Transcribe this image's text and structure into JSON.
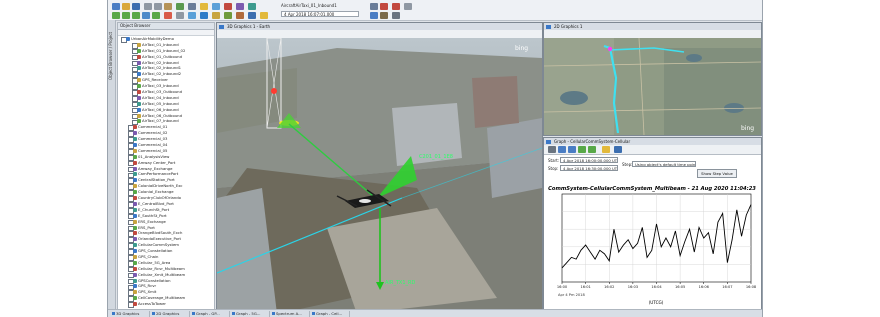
{
  "window": {
    "title": "AircraftAirTaxi_01_Inbound1",
    "datetime": "4 Apr 2018 16:07:01.000"
  },
  "sidebar_tab": "Object Browser / Project",
  "browser": {
    "title": "Object Browser",
    "items": [
      "UrbanAirMobilityDemo",
      "AirTaxi_01_Inbound",
      "AirTaxi_01_Inbound_02",
      "AirTaxi_01_Outbound",
      "AirTaxi_02_Inbound",
      "AirTaxi_02_Inbound1",
      "AirTaxi_02_Inbound2",
      "GPS_Receiver",
      "AirTaxi_03_Inbound",
      "AirTaxi_03_Outbound",
      "AirTaxi_04_Inbound",
      "AirTaxi_05_Inbound",
      "AirTaxi_06_Inbound",
      "AirTaxi_06_Outbound",
      "AirTaxi_07_Inbound",
      "Commercial_01",
      "Commercial_02",
      "Commercial_03",
      "Commercial_04",
      "Commercial_05",
      "01_AnalysisView",
      "Amway Center_Port",
      "Amway_Exchange",
      "CamPerformancePort",
      "CentralStation_Port",
      "ColonialDriveNorth_Exc",
      "Colonial_Exchange",
      "CountryClubOfOrlando",
      "E_CentralBlvd_Port",
      "E_ChurchSt_Port",
      "E_SouthSt_Port",
      "ERS_Exchange",
      "ERS_Port",
      "OrangeBlvdSouth_Exch",
      "OrlandoExecutive_Port",
      "CellularCommSystem",
      "GPS_Constellation",
      "GPS_Chain",
      "Cellular_5G_Area",
      "Cellular_Rcvr_Multibeam",
      "Cellular_Xmit_Multibeam",
      "GPSConstellation",
      "GPS_Rcvr",
      "GPS_Xmit",
      "CellCoverage_Multibeam",
      "AccessToTower"
    ]
  },
  "view3d": {
    "title": "3D Graphics 1 - Earth",
    "label_top": "C201_01_1E8",
    "label_bottom": "AIR_TX1_RD",
    "watermark": "bing"
  },
  "view2d": {
    "title": "2D Graphics 1",
    "watermark": "bing"
  },
  "graph": {
    "title": "Graph - CellularCommSystem-Cellular",
    "start_label": "Start:",
    "start_value": "4 Apr 2018 16:00:00.000 UTCG",
    "stop_label": "Stop:",
    "stop_value": "4 Apr 2018 16:30:00.000 UTCG",
    "step_label": "Step:",
    "step_value": "Using object's default time points",
    "show_step": "Show Step Value",
    "footer_note": "CommSystem-CellularCommSystem_Multibeam  Graph_All_Cellular_Rcvr_Multibeam",
    "xlabel": "(UTCG)"
  },
  "chart_data": {
    "type": "line",
    "title": "CommSystem-CellularCommSystem_Multibeam - 21 Aug 2020 11:04:23",
    "xlabel": "(UTCG)",
    "x_tick_labels": [
      "16:00",
      "16:01",
      "16:02",
      "16:03",
      "16:04",
      "16:05",
      "16:06",
      "16:07",
      "16:08"
    ],
    "x_start_label": "Apr 4 Pm 2018",
    "series": [
      {
        "x": [
          0,
          0.2,
          0.4,
          0.6,
          0.8,
          1.0,
          1.2,
          1.4,
          1.6,
          1.8,
          2.0,
          2.2,
          2.4,
          2.6,
          2.8,
          3.0,
          3.2,
          3.4,
          3.6,
          3.8,
          4.0,
          4.2,
          4.4,
          4.6,
          4.8,
          5.0,
          5.2,
          5.4,
          5.6,
          5.8,
          6.0,
          6.2,
          6.4,
          6.6,
          6.8,
          7.0,
          7.2,
          7.4,
          7.6,
          7.8,
          8.0
        ],
        "y": [
          0.16,
          0.22,
          0.28,
          0.26,
          0.36,
          0.42,
          0.34,
          0.26,
          0.36,
          0.32,
          0.24,
          0.6,
          0.34,
          0.42,
          0.48,
          0.38,
          0.44,
          0.62,
          0.28,
          0.36,
          0.66,
          0.4,
          0.5,
          0.4,
          0.58,
          0.3,
          0.46,
          0.6,
          0.34,
          0.62,
          0.5,
          0.56,
          0.32,
          0.68,
          0.78,
          0.22,
          0.48,
          0.82,
          0.52,
          0.76,
          0.88
        ]
      }
    ],
    "ylim": [
      0,
      1
    ],
    "grid": true,
    "colors": {
      "line": "#000000",
      "title": "#000000"
    }
  },
  "taskbar": [
    "3D Graphics",
    "2D Graphics",
    "Graph - GP...",
    "Graph - 5G...",
    "Spectrum A...",
    "Graph - Cell..."
  ]
}
